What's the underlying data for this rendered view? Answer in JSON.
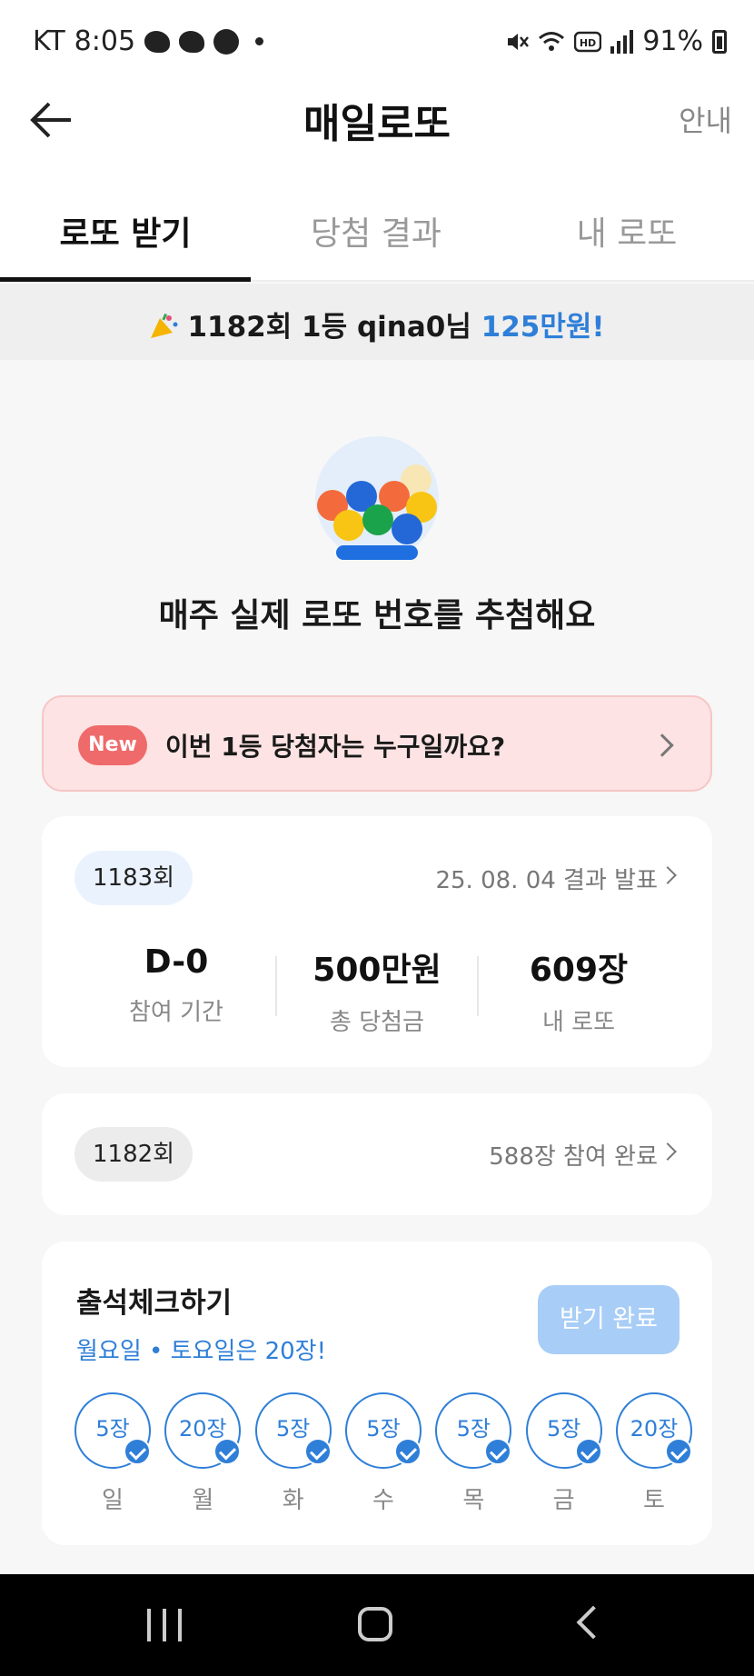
{
  "status_bar": {
    "carrier": "KT",
    "time": "8:05",
    "battery": "91%"
  },
  "header": {
    "title": "매일로또",
    "info_label": "안내"
  },
  "tabs": [
    {
      "label": "로또 받기",
      "active": true
    },
    {
      "label": "당첨 결과",
      "active": false
    },
    {
      "label": "내 로또",
      "active": false
    }
  ],
  "ticker": {
    "text": "1182회 1등 qina0님 ",
    "amount": "125만원!"
  },
  "hero": {
    "text": "매주 실제 로또 번호를 추첨해요"
  },
  "banner": {
    "badge": "New",
    "text": "이번 1등 당첨자는 누구일까요?"
  },
  "current_round": {
    "round": "1183회",
    "link": "25. 08. 04 결과 발표",
    "stats": [
      {
        "value": "D-0",
        "label": "참여 기간"
      },
      {
        "value": "500만원",
        "label": "총 당첨금"
      },
      {
        "value": "609장",
        "label": "내 로또"
      }
    ]
  },
  "previous_round": {
    "round": "1182회",
    "link": "588장 참여 완료"
  },
  "attendance": {
    "title": "출석체크하기",
    "subtitle": "월요일 • 토요일은 20장!",
    "button": "받기 완료",
    "days": [
      {
        "amount": "5장",
        "label": "일"
      },
      {
        "amount": "20장",
        "label": "월"
      },
      {
        "amount": "5장",
        "label": "화"
      },
      {
        "amount": "5장",
        "label": "수"
      },
      {
        "amount": "5장",
        "label": "목"
      },
      {
        "amount": "5장",
        "label": "금"
      },
      {
        "amount": "20장",
        "label": "토"
      }
    ]
  },
  "colors": {
    "accent": "#2f7fd8",
    "banner_bg": "#fde3e3",
    "badge": "#ef6a6a",
    "disabled_button": "#a8cdf6"
  }
}
